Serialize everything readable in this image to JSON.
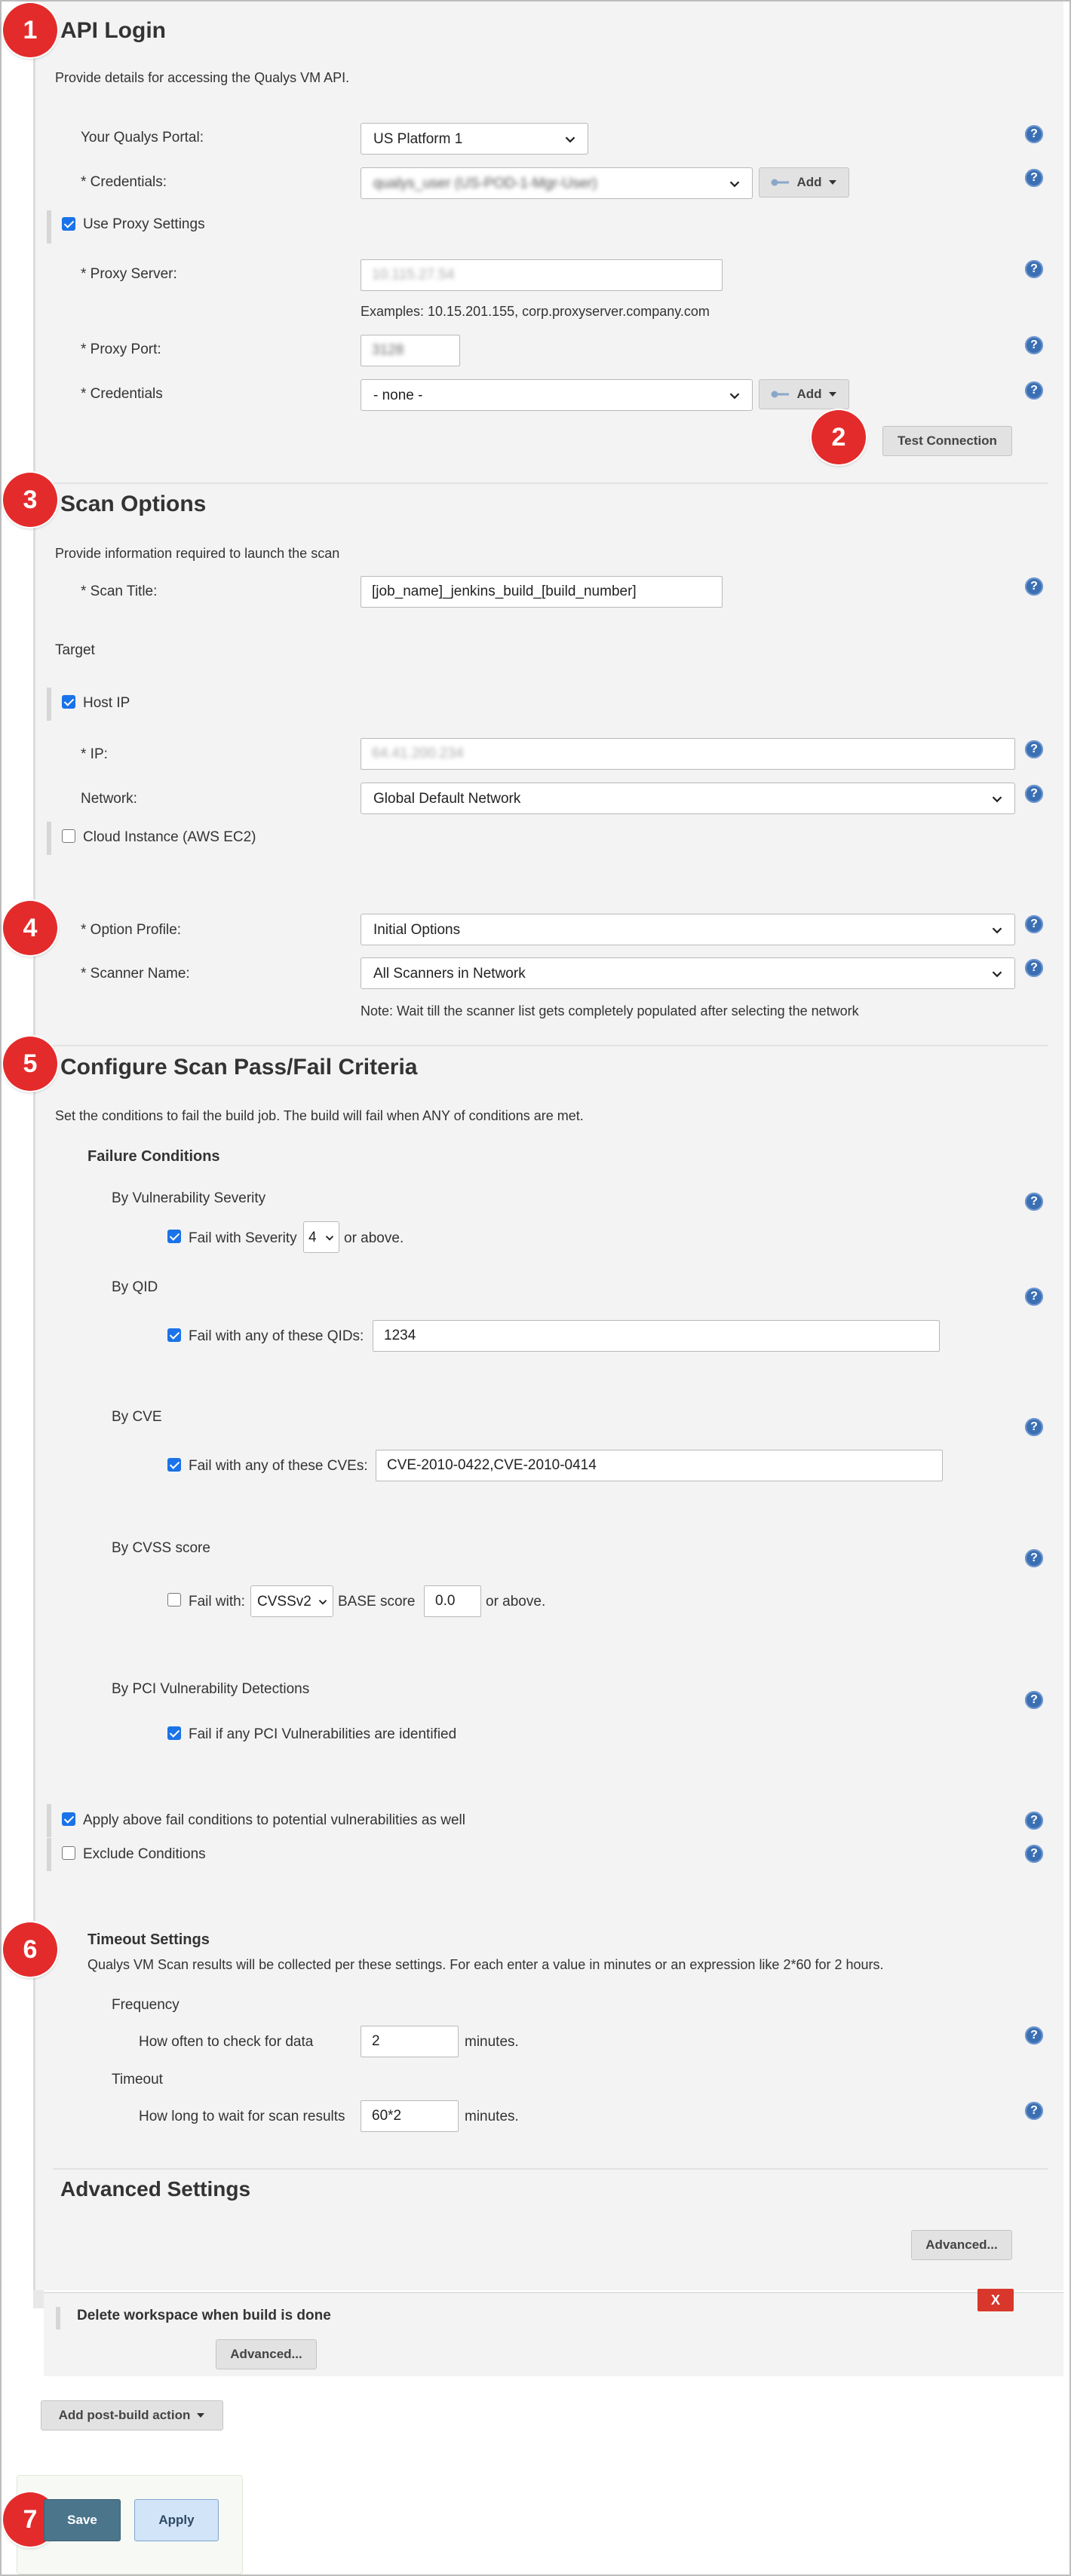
{
  "api_login": {
    "badge": "1",
    "title": "API Login",
    "description": "Provide details for accessing the Qualys VM API.",
    "portal_label": "Your Qualys Portal:",
    "portal_value": "US Platform 1",
    "credentials_label": "* Credentials:",
    "credentials_value": "qualys_user (US-POD-1-Mgr-User)",
    "add_label": "Add",
    "use_proxy_label": "Use Proxy Settings",
    "proxy_server_label": "* Proxy Server:",
    "proxy_server_value": "10.115.27.54",
    "proxy_examples": "Examples: 10.15.201.155, corp.proxyserver.company.com",
    "proxy_port_label": "* Proxy Port:",
    "proxy_port_value": "3128",
    "proxy_credentials_label": "* Credentials",
    "proxy_credentials_value": "- none -",
    "test_badge": "2",
    "test_connection_label": "Test Connection"
  },
  "scan_options": {
    "badge": "3",
    "title": "Scan Options",
    "description": "Provide information required to launch the scan",
    "scan_title_label": "* Scan Title:",
    "scan_title_value": "[job_name]_jenkins_build_[build_number]",
    "target_label": "Target",
    "host_ip_label": "Host IP",
    "ip_label": "* IP:",
    "ip_value": "64.41.200.234",
    "network_label": "Network:",
    "network_value": "Global Default Network",
    "cloud_label": "Cloud Instance (AWS EC2)",
    "profile_badge": "4",
    "option_profile_label": "* Option Profile:",
    "option_profile_value": "Initial Options",
    "scanner_label": "* Scanner Name:",
    "scanner_value": "All Scanners in Network",
    "scanner_note": "Note: Wait till the scanner list gets completely populated after selecting the network"
  },
  "criteria": {
    "badge": "5",
    "title": "Configure Scan Pass/Fail Criteria",
    "description": "Set the conditions to fail the build job. The build will fail when ANY of conditions are met.",
    "failure_conditions": "Failure Conditions",
    "severity_heading": "By Vulnerability Severity",
    "severity_label": "Fail with Severity",
    "severity_value": "4",
    "severity_suffix": "or above.",
    "qid_heading": "By QID",
    "qid_label": "Fail with any of these QIDs:",
    "qid_value": "1234",
    "cve_heading": "By CVE",
    "cve_label": "Fail with any of these CVEs:",
    "cve_value": "CVE-2010-0422,CVE-2010-0414",
    "cvss_heading": "By CVSS score",
    "cvss_label": "Fail with:",
    "cvss_version": "CVSSv2",
    "cvss_base_label": "BASE score",
    "cvss_value": "0.0",
    "cvss_suffix": "or above.",
    "pci_heading": "By PCI Vulnerability Detections",
    "pci_label": "Fail if any PCI Vulnerabilities are identified",
    "apply_potential_label": "Apply above fail conditions to potential vulnerabilities as well",
    "exclude_label": "Exclude Conditions"
  },
  "timeout": {
    "badge": "6",
    "title": "Timeout Settings",
    "description": "Qualys VM Scan results will be collected per these settings. For each enter a value in minutes or an expression like 2*60 for 2 hours.",
    "frequency_heading": "Frequency",
    "frequency_label": "How often to check for data",
    "frequency_value": "2",
    "frequency_unit": "minutes.",
    "timeout_heading": "Timeout",
    "timeout_label": "How long to wait for scan results",
    "timeout_value": "60*2",
    "timeout_unit": "minutes."
  },
  "advanced": {
    "title": "Advanced Settings",
    "button_label": "Advanced..."
  },
  "post_build": {
    "delete_label": "Delete workspace when build is done",
    "delete_x": "X",
    "advanced_label": "Advanced...",
    "add_action_label": "Add post-build action"
  },
  "footer": {
    "badge": "7",
    "save_label": "Save",
    "apply_label": "Apply"
  },
  "help_glyph": "?"
}
